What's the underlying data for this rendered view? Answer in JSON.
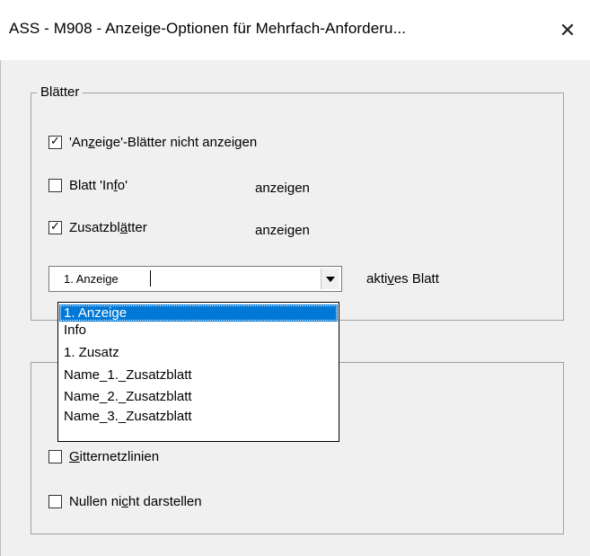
{
  "window": {
    "title": "ASS - M908 - Anzeige-Optionen für Mehrfach-Anforderu...",
    "close_glyph": "✕"
  },
  "group_sheets": {
    "legend": "Blätter",
    "hide_display_sheets": {
      "label_pre": "'An",
      "label_u": "z",
      "label_post": "eige'-Blätter nicht anzeigen",
      "checked": true
    },
    "sheet_info": {
      "label_pre": "Blatt 'In",
      "label_u": "f",
      "label_post": "o'",
      "suffix": "anzeigen",
      "checked": false
    },
    "extra_sheets": {
      "label_pre": "Zusatzbl",
      "label_u": "ä",
      "label_post": "tter",
      "suffix": "anzeigen",
      "checked": true
    },
    "active_sheet": {
      "value": "1. Anzeige",
      "label_pre": "akti",
      "label_u": "v",
      "label_post": "es Blatt",
      "options": [
        "1. Anzeige",
        "Info",
        "1. Zusatz",
        "Name_1._Zusatzblatt",
        "Name_2._Zusatzblatt",
        "Name_3._Zusatzblatt"
      ],
      "selected_index": 0
    }
  },
  "group_view": {
    "gridlines": {
      "label_pre": "",
      "label_u": "G",
      "label_post": "itternetzlinien",
      "checked": false
    },
    "hide_zeros": {
      "label_pre": "Nullen ni",
      "label_u": "c",
      "label_post": "ht darstellen",
      "checked": false
    }
  },
  "glyphs": {
    "check": "✓"
  }
}
